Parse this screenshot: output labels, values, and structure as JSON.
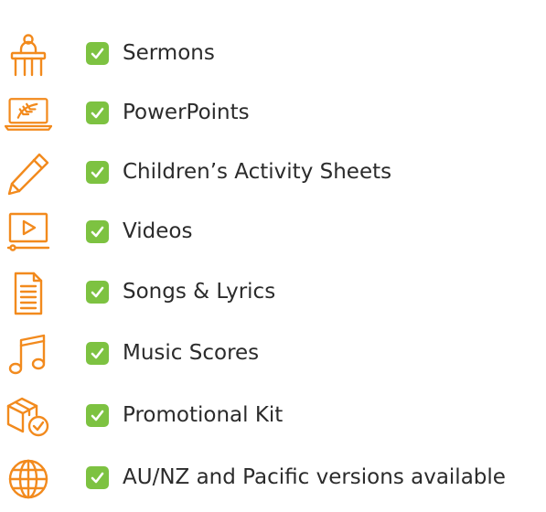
{
  "colors": {
    "icon": "#f28a1d",
    "check_bg": "#7dc241",
    "check_mark": "#ffffff",
    "text": "#2b2b2b",
    "background": "#ffffff"
  },
  "check_mark_glyph": "✓",
  "features": [
    {
      "label": "Sermons",
      "icon": "pulpit-icon"
    },
    {
      "label": "PowerPoints",
      "icon": "laptop-icon"
    },
    {
      "label": "Children’s Activity Sheets",
      "icon": "pencil-icon"
    },
    {
      "label": "Videos",
      "icon": "video-play-icon"
    },
    {
      "label": "Songs & Lyrics",
      "icon": "document-icon"
    },
    {
      "label": "Music Scores",
      "icon": "music-notes-icon"
    },
    {
      "label": "Promotional Kit",
      "icon": "box-check-icon"
    },
    {
      "label": "AU/NZ and Pacific versions available",
      "icon": "globe-icon"
    }
  ]
}
